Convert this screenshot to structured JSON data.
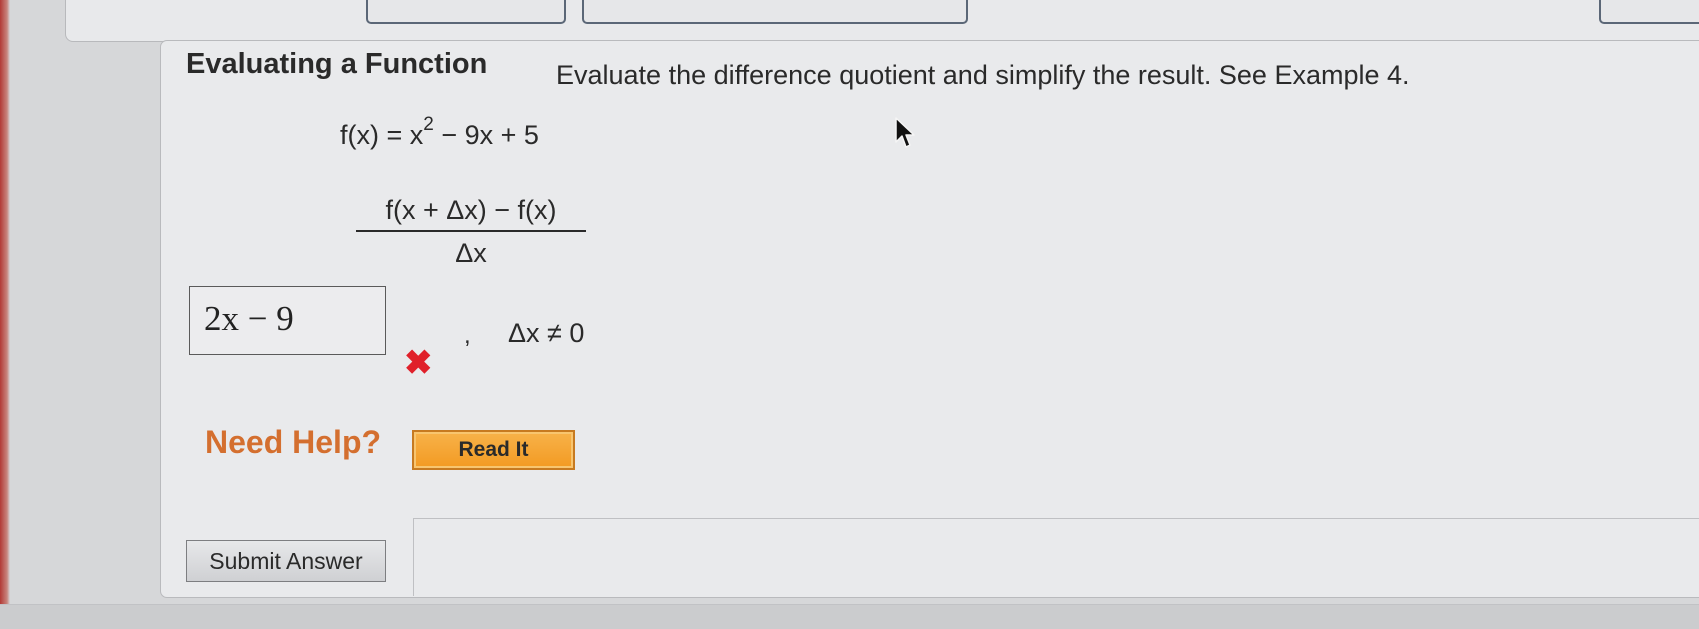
{
  "problem": {
    "title": "Evaluating a Function",
    "instructions": "Evaluate the difference quotient and simplify the result. See Example 4.",
    "function_lhs": "f(x) = x",
    "function_exponent": "2",
    "function_rhs": " − 9x + 5",
    "quotient_numerator": "f(x + Δx) − f(x)",
    "quotient_denominator": "Δx"
  },
  "answer": {
    "value": "2x − 9",
    "status_icon": "x-mark-icon",
    "status_color": "#e0202a",
    "separator": ",",
    "restriction": "Δx ≠ 0"
  },
  "help": {
    "label": "Need Help?",
    "read_it_label": "Read It",
    "label_color": "#d46f2f",
    "button_color": "#f39a22"
  },
  "actions": {
    "submit_label": "Submit Answer"
  }
}
